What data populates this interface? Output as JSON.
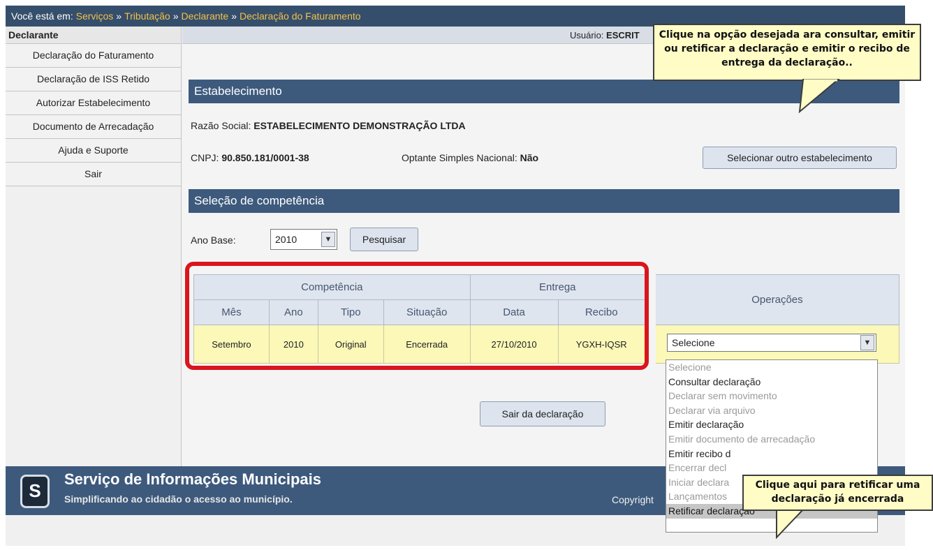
{
  "breadcrumb": {
    "prefix": "Você está em:",
    "items": [
      "Serviços",
      "Tributação",
      "Declarante",
      "Declaração do Faturamento"
    ],
    "separator": "»"
  },
  "sidebar": {
    "title": "Declarante",
    "items": [
      {
        "label": "Declaração do Faturamento"
      },
      {
        "label": "Declaração de ISS Retido"
      },
      {
        "label": "Autorizar Estabelecimento"
      },
      {
        "label": "Documento de Arrecadação"
      },
      {
        "label": "Ajuda e Suporte"
      },
      {
        "label": "Sair"
      }
    ]
  },
  "userbar": {
    "label": "Usuário:",
    "value": "ESCRIT"
  },
  "estabelecimento": {
    "title": "Estabelecimento",
    "razao_label": "Razão Social:",
    "razao_value": "ESTABELECIMENTO DEMONSTRAÇÃO LTDA",
    "cnpj_label": "CNPJ:",
    "cnpj_value": "90.850.181/0001-38",
    "simples_label": "Optante Simples Nacional:",
    "simples_value": "Não",
    "change_button": "Selecionar outro estabelecimento"
  },
  "competencia": {
    "title": "Seleção de competência",
    "ano_label": "Ano Base:",
    "ano_value": "2010",
    "search_button": "Pesquisar"
  },
  "table": {
    "group_headers": {
      "competencia": "Competência",
      "entrega": "Entrega",
      "operacoes": "Operações"
    },
    "columns": [
      "Mês",
      "Ano",
      "Tipo",
      "Situação",
      "Data",
      "Recibo"
    ],
    "row": {
      "mes": "Setembro",
      "ano": "2010",
      "tipo": "Original",
      "situacao": "Encerrada",
      "data": "27/10/2010",
      "recibo": "YGXH-IQSR"
    }
  },
  "operacoes": {
    "selected": "Selecione",
    "options": [
      {
        "label": "Selecione",
        "disabled": true
      },
      {
        "label": "Consultar declaração",
        "disabled": false
      },
      {
        "label": "Declarar sem movimento",
        "disabled": true
      },
      {
        "label": "Declarar via arquivo",
        "disabled": true
      },
      {
        "label": "Emitir declaração",
        "disabled": false
      },
      {
        "label": "Emitir documento de arrecadação",
        "disabled": true
      },
      {
        "label": "Emitir recibo d",
        "disabled": false
      },
      {
        "label": "Encerrar decl",
        "disabled": true
      },
      {
        "label": "Iniciar declara",
        "disabled": true
      },
      {
        "label": "Lançamentos",
        "disabled": true
      },
      {
        "label": "Retificar declaração",
        "disabled": false,
        "highlighted": true
      }
    ]
  },
  "exit_button": "Sair da declaração",
  "footer": {
    "logo_letter": "S",
    "title": "Serviço de Informações Municipais",
    "subtitle": "Simplificando ao cidadão o acesso ao município.",
    "copyright": "Copyright"
  },
  "tooltips": {
    "top": "Clique na opção desejada ara consultar, emitir ou retificar a declaração e emitir o recibo de entrega da declaração..",
    "bottom": "Clique aqui para retificar uma declaração já encerrada"
  },
  "colors": {
    "highlight_box": "#d8161c",
    "section_bar": "#3d5a7d",
    "row_bg": "#fbf8b8",
    "breadcrumb_link": "#f2c14a"
  }
}
